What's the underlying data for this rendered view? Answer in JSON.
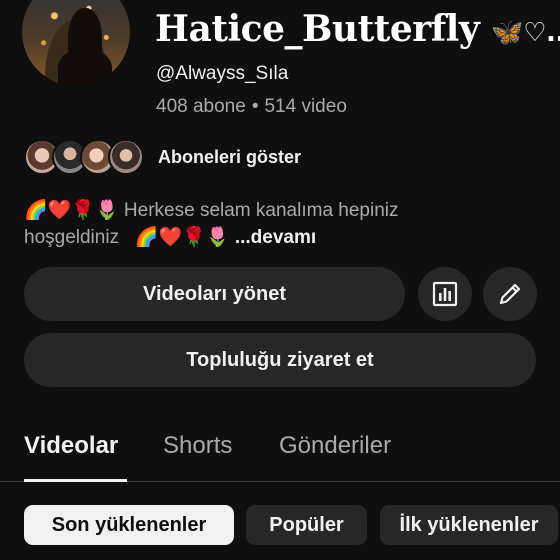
{
  "channel": {
    "name": "Hatice_Butterfly",
    "name_suffix": "🦋♡..",
    "handle": "@Alwayss_Sıla",
    "subscribers": "408 abone",
    "separator": "•",
    "videos": "514 video"
  },
  "subscribers_row": {
    "label": "Aboneleri göster"
  },
  "description": {
    "emojis_1": "🌈❤️🌹🌷",
    "text_1": "Herkese selam kanalıma hepiniz",
    "text_2": "hoşgeldiniz",
    "emojis_2": "🌈❤️🌹🌷",
    "more": "...devamı"
  },
  "actions": {
    "manage_videos": "Videoları yönet",
    "visit_community": "Topluluğu ziyaret et",
    "analytics_icon": "bar-chart-icon",
    "edit_icon": "pencil-icon"
  },
  "tabs": [
    {
      "label": "Videolar",
      "active": true
    },
    {
      "label": "Shorts",
      "active": false
    },
    {
      "label": "Gönderiler",
      "active": false
    }
  ],
  "chips": [
    {
      "label": "Son yüklenenler",
      "selected": true
    },
    {
      "label": "Popüler",
      "selected": false
    },
    {
      "label": "İlk yüklenenler",
      "selected": false
    }
  ],
  "colors": {
    "background": "#0f0f0f",
    "surface": "#272727",
    "text_primary": "#f1f1f1",
    "text_secondary": "#aaaaaa"
  }
}
